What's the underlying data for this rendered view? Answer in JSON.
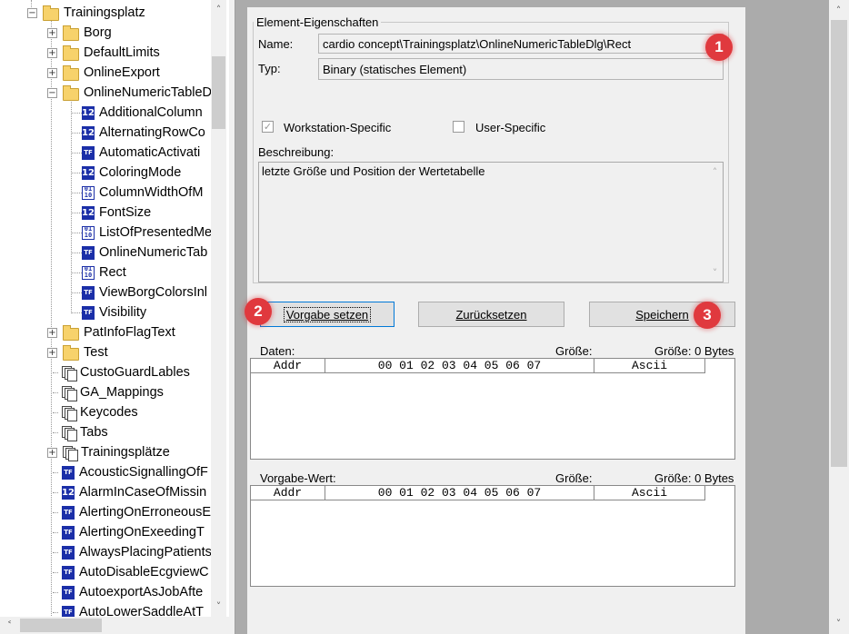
{
  "tree": {
    "items": [
      {
        "label": "Trainingsplatz",
        "icon": "folder",
        "level": 0,
        "expander": "−"
      },
      {
        "label": "Borg",
        "icon": "folder",
        "level": 1,
        "expander": "+"
      },
      {
        "label": "DefaultLimits",
        "icon": "folder",
        "level": 1,
        "expander": "+"
      },
      {
        "label": "OnlineExport",
        "icon": "folder",
        "level": 1,
        "expander": "+"
      },
      {
        "label": "OnlineNumericTableD",
        "icon": "folder",
        "level": 1,
        "expander": "−"
      },
      {
        "label": "AdditionalColumn",
        "icon": "int",
        "level": 2
      },
      {
        "label": "AlternatingRowCo",
        "icon": "int",
        "level": 2
      },
      {
        "label": "AutomaticActivati",
        "icon": "bool",
        "level": 2
      },
      {
        "label": "ColoringMode",
        "icon": "int",
        "level": 2
      },
      {
        "label": "ColumnWidthOfM",
        "icon": "binary",
        "level": 2
      },
      {
        "label": "FontSize",
        "icon": "int",
        "level": 2
      },
      {
        "label": "ListOfPresentedMe",
        "icon": "binary",
        "level": 2
      },
      {
        "label": "OnlineNumericTab",
        "icon": "bool",
        "level": 2
      },
      {
        "label": "Rect",
        "icon": "binary",
        "level": 2
      },
      {
        "label": "ViewBorgColorsInl",
        "icon": "bool",
        "level": 2
      },
      {
        "label": "Visibility",
        "icon": "bool",
        "level": 2
      },
      {
        "label": "PatInfoFlagText",
        "icon": "folder",
        "level": 1,
        "expander": "+"
      },
      {
        "label": "Test",
        "icon": "folder",
        "level": 1,
        "expander": "+"
      },
      {
        "label": "CustoGuardLables",
        "icon": "doc",
        "level": 1
      },
      {
        "label": "GA_Mappings",
        "icon": "doc",
        "level": 1
      },
      {
        "label": "Keycodes",
        "icon": "doc",
        "level": 1
      },
      {
        "label": "Tabs",
        "icon": "doc",
        "level": 1
      },
      {
        "label": "Trainingsplätze",
        "icon": "doc",
        "level": 1,
        "expander": "+"
      },
      {
        "label": "AcousticSignallingOfF",
        "icon": "bool",
        "level": 1
      },
      {
        "label": "AlarmInCaseOfMissin",
        "icon": "int",
        "level": 1
      },
      {
        "label": "AlertingOnErroneousE",
        "icon": "bool",
        "level": 1
      },
      {
        "label": "AlertingOnExeedingT",
        "icon": "bool",
        "level": 1
      },
      {
        "label": "AlwaysPlacingPatients",
        "icon": "bool",
        "level": 1
      },
      {
        "label": "AutoDisableEcgviewC",
        "icon": "bool",
        "level": 1
      },
      {
        "label": "AutoexportAsJobAfte",
        "icon": "bool",
        "level": 1
      },
      {
        "label": "AutoLowerSaddleAtT",
        "icon": "bool",
        "level": 1
      }
    ],
    "icon_text": {
      "int": "12",
      "bool": "TF",
      "binary": "01\n10"
    }
  },
  "props": {
    "group_title": "Element-Eigenschaften",
    "name_label": "Name:",
    "name_value": "cardio concept\\Trainingsplatz\\OnlineNumericTableDlg\\Rect",
    "type_label": "Typ:",
    "type_value": "Binary (statisches Element)",
    "workstation_label": "Workstation-Specific",
    "workstation_checked": true,
    "user_label": "User-Specific",
    "user_checked": false,
    "desc_label": "Beschreibung:",
    "desc_value": "letzte Größe und Position der Wertetabelle"
  },
  "buttons": {
    "default": "Vorgabe setzen",
    "reset": "Zurücksetzen",
    "save": "Speichern"
  },
  "data_section": {
    "label": "Daten:",
    "size_label": "Größe:",
    "size_bytes": "Größe: 0 Bytes",
    "col_addr": "Addr",
    "col_hex": "00 01 02 03 04 05 06 07",
    "col_ascii": "Ascii"
  },
  "default_section": {
    "label": "Vorgabe-Wert:",
    "size_label": "Größe:",
    "size_bytes": "Größe: 0 Bytes",
    "col_addr": "Addr",
    "col_hex": "00 01 02 03 04 05 06 07",
    "col_ascii": "Ascii"
  },
  "badges": [
    "1",
    "2",
    "3"
  ],
  "colors": {
    "badge": "#e0393e",
    "icon_blue": "#1b2fa8",
    "panel_bg": "#ababab"
  }
}
